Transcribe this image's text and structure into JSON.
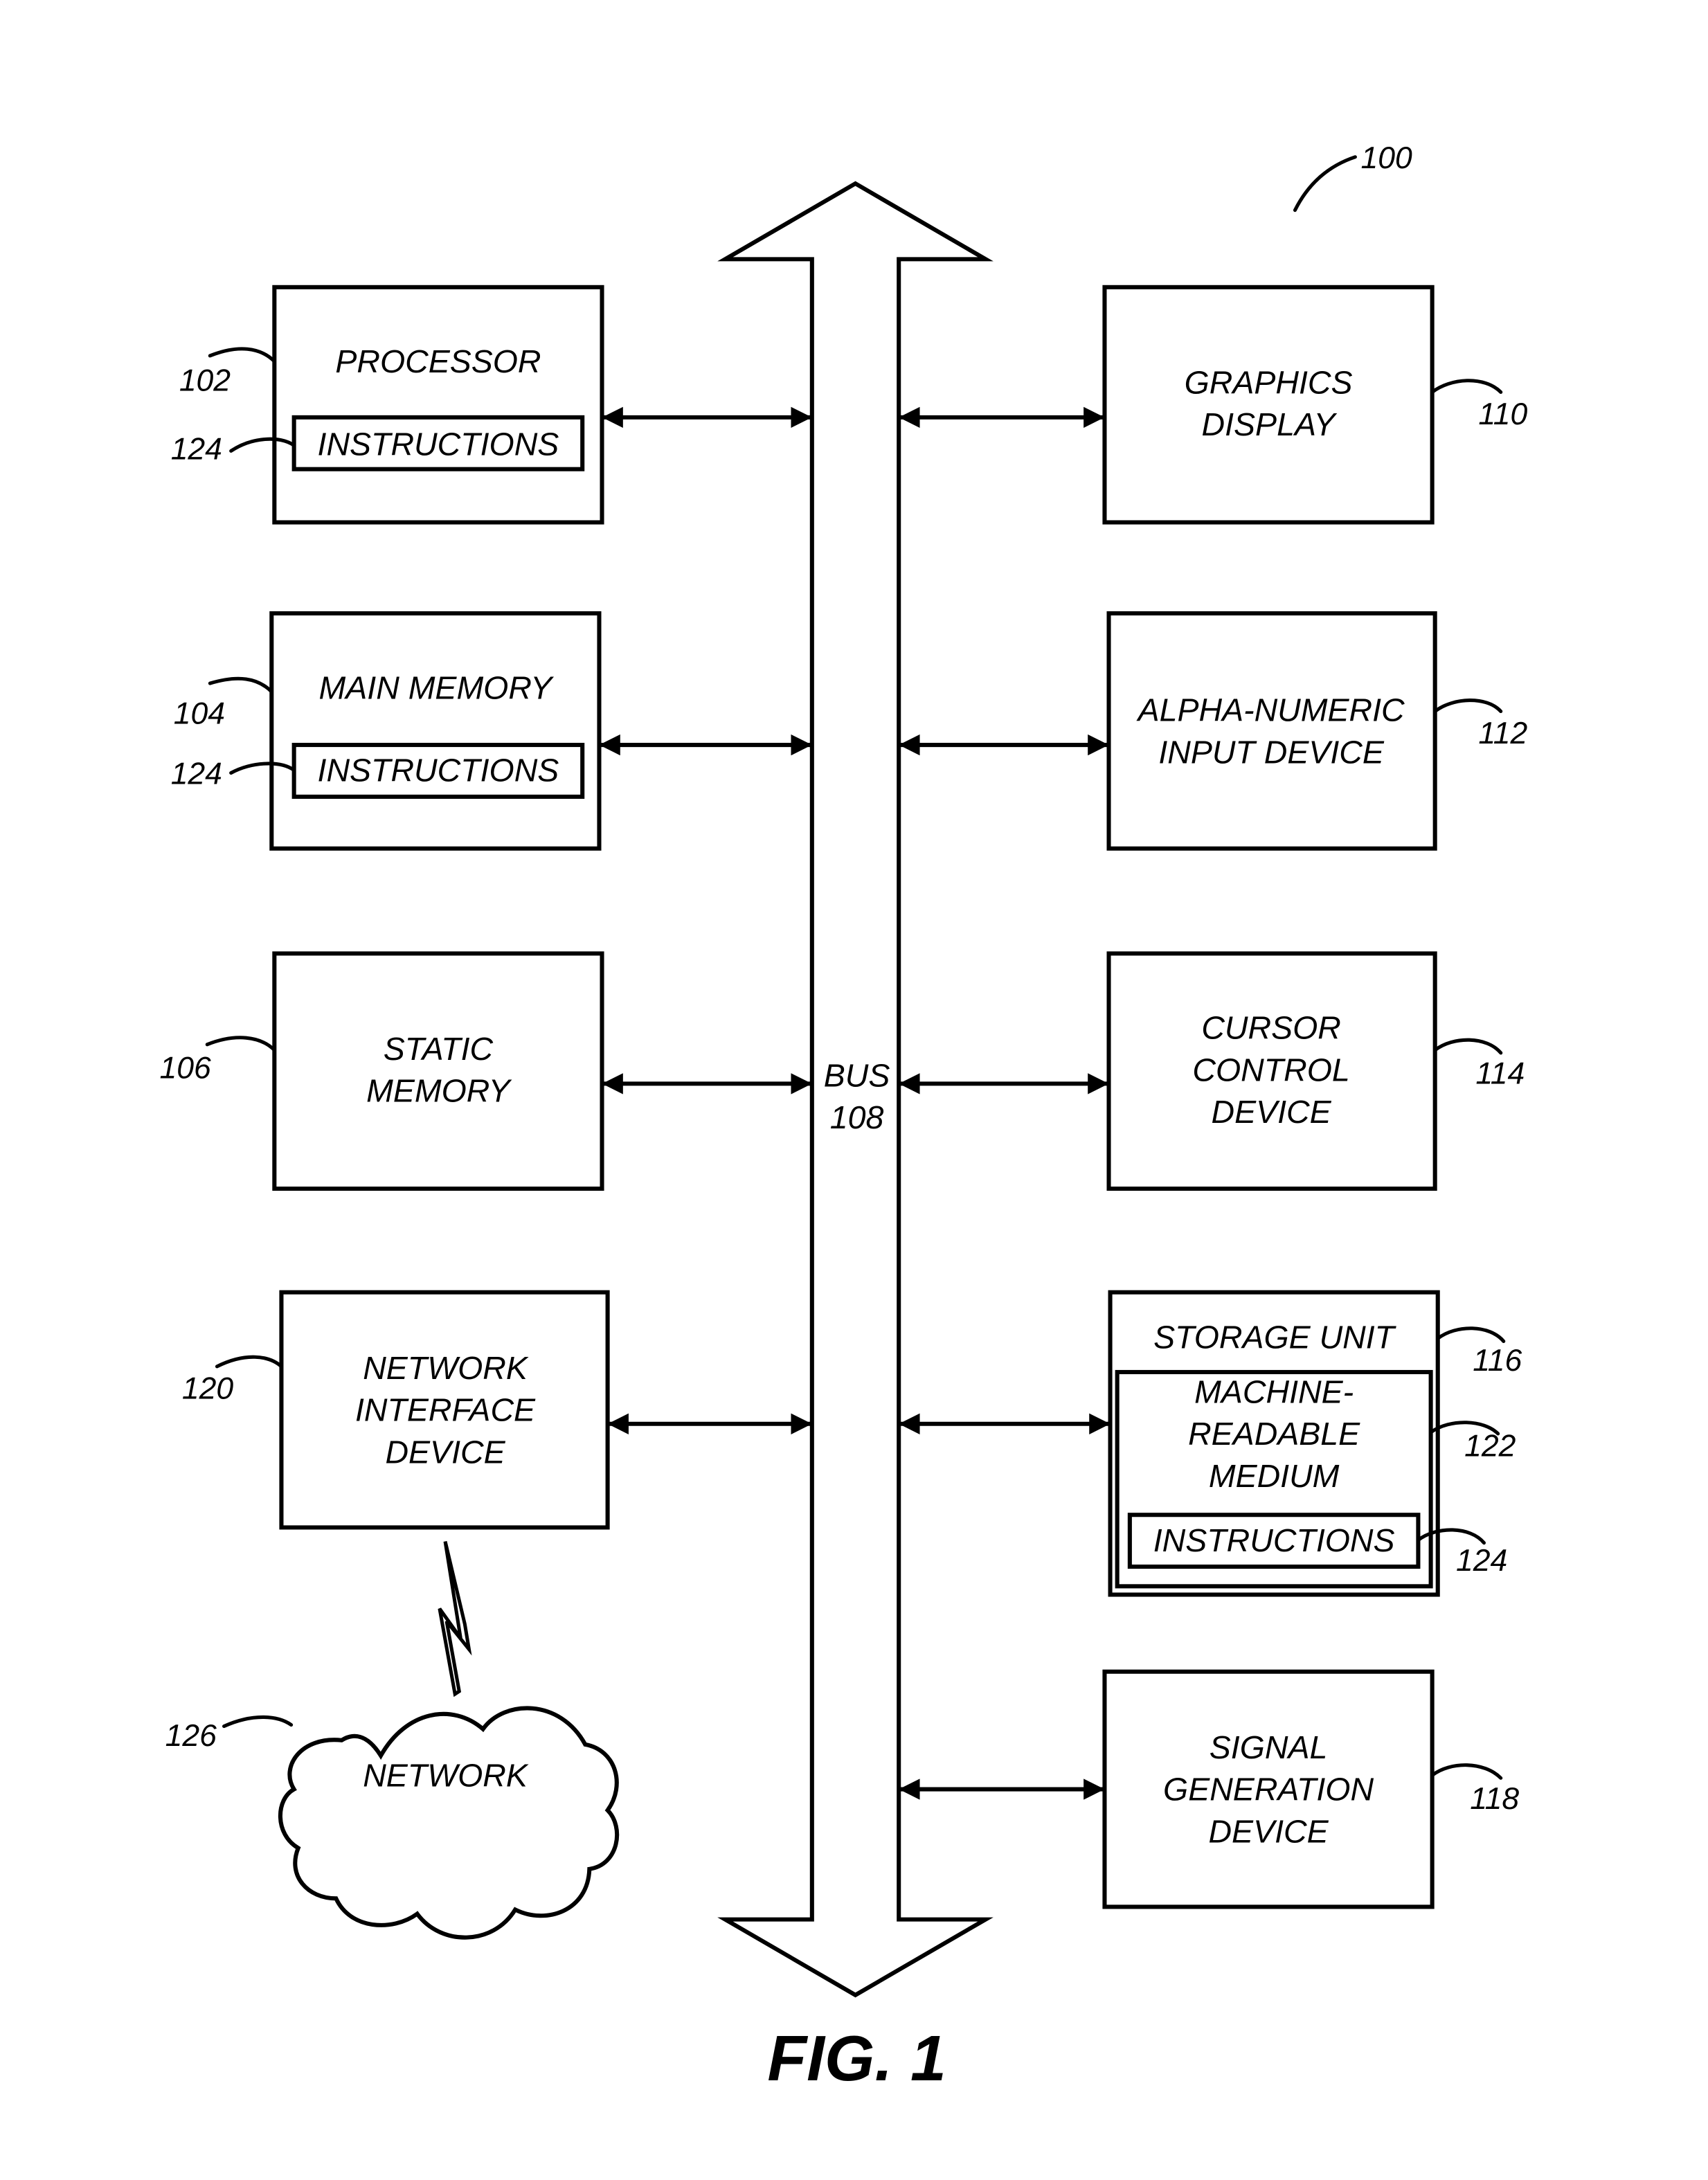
{
  "figure": {
    "caption": "FIG. 1",
    "system_ref": "100"
  },
  "bus": {
    "label": "BUS",
    "ref": "108"
  },
  "left_components": [
    {
      "id": "processor",
      "lines": [
        "PROCESSOR"
      ],
      "ref": "102",
      "inner": {
        "label": "INSTRUCTIONS",
        "ref": "124"
      }
    },
    {
      "id": "main-memory",
      "lines": [
        "MAIN MEMORY"
      ],
      "ref": "104",
      "inner": {
        "label": "INSTRUCTIONS",
        "ref": "124"
      }
    },
    {
      "id": "static-memory",
      "lines": [
        "STATIC",
        "MEMORY"
      ],
      "ref": "106"
    },
    {
      "id": "network-interface-device",
      "lines": [
        "NETWORK",
        "INTERFACE",
        "DEVICE"
      ],
      "ref": "120"
    }
  ],
  "right_components": [
    {
      "id": "graphics-display",
      "lines": [
        "GRAPHICS",
        "DISPLAY"
      ],
      "ref": "110"
    },
    {
      "id": "alpha-numeric-input-device",
      "lines": [
        "ALPHA-NUMERIC",
        "INPUT DEVICE"
      ],
      "ref": "112"
    },
    {
      "id": "cursor-control-device",
      "lines": [
        "CURSOR",
        "CONTROL",
        "DEVICE"
      ],
      "ref": "114"
    },
    {
      "id": "storage-unit",
      "lines": [
        "STORAGE UNIT"
      ],
      "ref": "116",
      "medium": {
        "lines": [
          "MACHINE-",
          "READABLE",
          "MEDIUM"
        ],
        "ref": "122"
      },
      "inner": {
        "label": "INSTRUCTIONS",
        "ref": "124"
      }
    },
    {
      "id": "signal-generation-device",
      "lines": [
        "SIGNAL",
        "GENERATION",
        "DEVICE"
      ],
      "ref": "118"
    }
  ],
  "network": {
    "label": "NETWORK",
    "ref": "126"
  }
}
